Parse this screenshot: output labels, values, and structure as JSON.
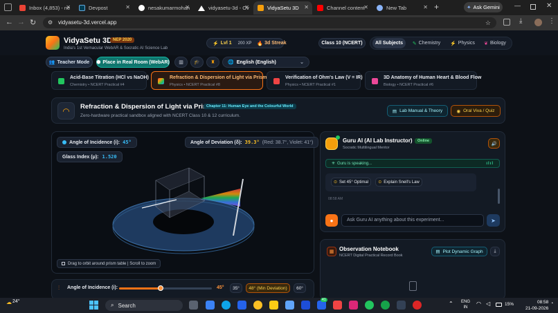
{
  "browser": {
    "tabs": [
      {
        "label": "Inbox (4,853) - ne",
        "color": "#ea4335"
      },
      {
        "label": "Devpost",
        "color": "#003e54"
      },
      {
        "label": "nesakumarmohan",
        "color": "#ffffff"
      },
      {
        "label": "vidyasetu-3d - Ov",
        "color": "#ffffff"
      },
      {
        "label": "VidyaSetu 3D",
        "color": "#f59e0b"
      },
      {
        "label": "Channel content",
        "color": "#ff0000"
      },
      {
        "label": "New Tab",
        "color": "#8ab4f8"
      }
    ],
    "new_tab": "+",
    "ask_gemini": "Ask Gemini",
    "url": "vidyasetu-3d.vercel.app"
  },
  "app": {
    "name": "VidyaSetu 3D",
    "badge": "NEP 2020",
    "tagline": "India's 1st Vernacular WebAR & Socratic AI Science Lab",
    "level": "Lvl 1",
    "xp": "200 XP",
    "streak": "3d Streak",
    "class_select": "Class 10 (NCERT)",
    "subjects": [
      "All Subjects",
      "Chemistry",
      "Physics",
      "Biology"
    ],
    "teacher_mode": "Teacher Mode",
    "place_real_room": "Place in Real Room (WebAR)",
    "language": "English (English)"
  },
  "practicals": [
    {
      "title": "Acid-Base Titration (HCl vs NaOH)",
      "sub": "Chemistry • NCERT Practical #4",
      "color": "#22c55e"
    },
    {
      "title": "Refraction & Dispersion of Light via Prism",
      "sub": "Physics • NCERT Practical #8",
      "color": "#f97316"
    },
    {
      "title": "Verification of Ohm's Law (V = IR)",
      "sub": "Physics • NCERT Practical #1",
      "color": "#ef4444"
    },
    {
      "title": "3D Anatomy of Human Heart & Blood Flow",
      "sub": "Biology • NCERT Practical #6",
      "color": "#ec4899"
    }
  ],
  "experiment": {
    "title": "Refraction & Dispersion of Light via Prism",
    "chapter": "Chapter 11: Human Eye and the Colourful World",
    "subtitle": "Zero-hardware practical sandbox aligned with NCERT Class 10 & 12 curriculum.",
    "lab_manual": "Lab Manual & Theory",
    "oral_viva": "Oral Viva / Quiz"
  },
  "viewer": {
    "incidence_label": "Angle of Incidence (i):",
    "incidence_value": "45°",
    "glass_label": "Glass Index (μ):",
    "glass_value": "1.520",
    "deviation_label": "Angle of Deviation (δ):",
    "deviation_value": "39.3°",
    "deviation_detail": "(Red: 38.7°, Violet: 41°)",
    "hint": "Drag to orbit around prism table | Scroll to zoom"
  },
  "controls": {
    "label": "Angle of Incidence (i):",
    "value": "45°",
    "slider_fraction": 0.45,
    "presets": [
      "35°",
      "48° (Min Deviation)",
      "60°"
    ]
  },
  "guru": {
    "title": "Guru AI (AI Lab Instructor)",
    "status": "Online",
    "subtitle": "Socratic Multilingual Mentor",
    "speaking": "Guru is speaking...",
    "chip1": "Set 45° Optimal",
    "chip2": "Explain Snell's Law",
    "time": "08:58 AM",
    "placeholder": "Ask Guru AI anything about this experiment..."
  },
  "notebook": {
    "title": "Observation Notebook",
    "subtitle": "NCERT Digital Practical Record Book",
    "plot": "Plot Dynamic Graph"
  },
  "taskbar": {
    "temp": "24°",
    "search": "Search",
    "lang1": "ENG",
    "lang2": "IN",
    "battery": "15%",
    "time": "08:58",
    "date": "21-09-2026",
    "badge": "41"
  }
}
